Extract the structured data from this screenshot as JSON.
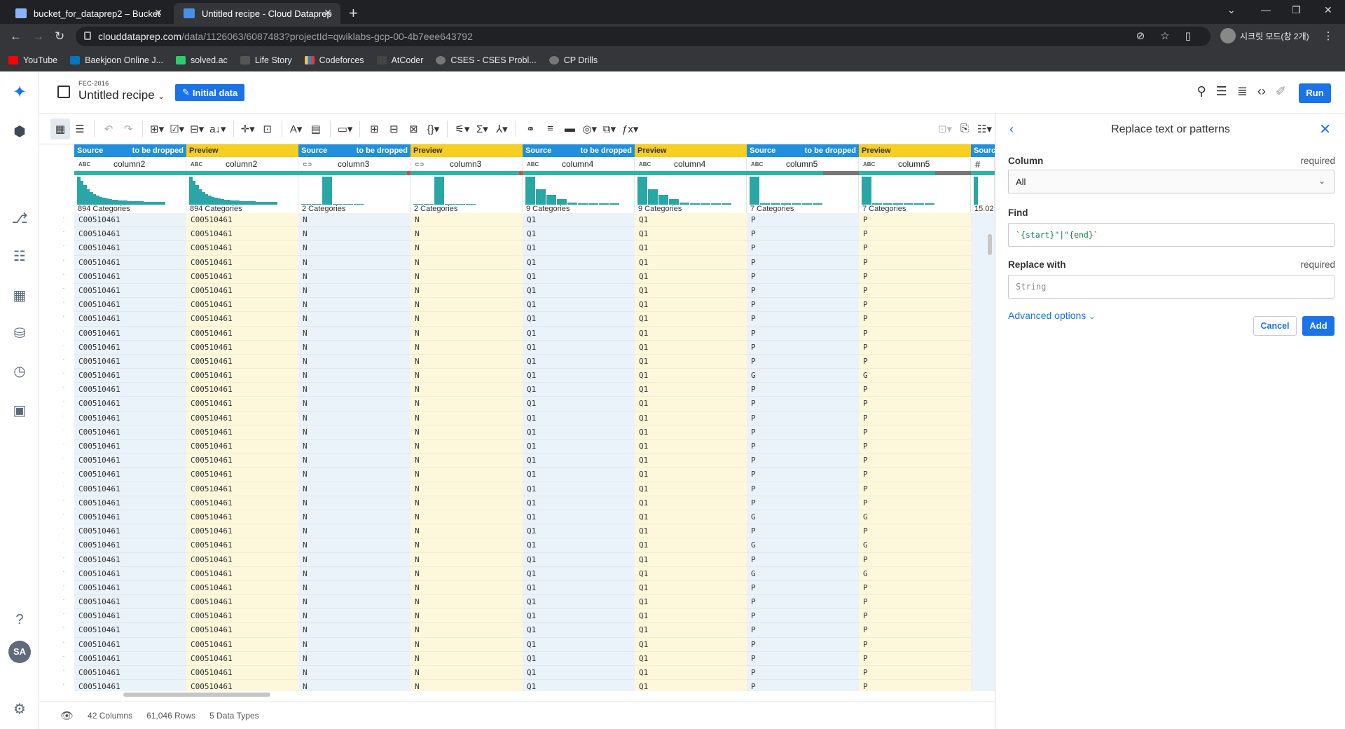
{
  "browser": {
    "tabs": [
      {
        "title": "bucket_for_dataprep2 – Bucket"
      },
      {
        "title": "Untitled recipe - Cloud Dataprep"
      }
    ],
    "url_domain": "clouddataprep.com",
    "url_path": "/data/1126063/6087483?projectId=qwiklabs-gcp-00-4b7eee643792",
    "profile_label": "시크릿 모드(창 2개)",
    "bookmarks": [
      "YouTube",
      "Baekjoon Online J...",
      "solved.ac",
      "Life Story",
      "Codeforces",
      "AtCoder",
      "CSES - CSES Probl...",
      "CP Drills"
    ]
  },
  "header": {
    "flow_name": "FEC-2016",
    "recipe_name": "Untitled recipe",
    "initial_data_label": "Initial data",
    "run_label": "Run"
  },
  "user": {
    "initials": "SA"
  },
  "grid": {
    "columns": [
      {
        "kind": "Source",
        "tag": "to be dropped",
        "type": "ABC",
        "name": "column2",
        "categories": "894 Categories"
      },
      {
        "kind": "Preview",
        "tag": "",
        "type": "ABC",
        "name": "column2",
        "categories": "894 Categories"
      },
      {
        "kind": "Source",
        "tag": "to be dropped",
        "type": "BOOL",
        "name": "column3",
        "categories": "2 Categories"
      },
      {
        "kind": "Preview",
        "tag": "",
        "type": "BOOL",
        "name": "column3",
        "categories": "2 Categories"
      },
      {
        "kind": "Source",
        "tag": "to be dropped",
        "type": "ABC",
        "name": "column4",
        "categories": "9 Categories"
      },
      {
        "kind": "Preview",
        "tag": "",
        "type": "ABC",
        "name": "column4",
        "categories": "9 Categories"
      },
      {
        "kind": "Source",
        "tag": "to be dropped",
        "type": "ABC",
        "name": "column5",
        "categories": "7 Categories"
      },
      {
        "kind": "Preview",
        "tag": "",
        "type": "ABC",
        "name": "column5",
        "categories": "7 Categories"
      }
    ],
    "partial_column": {
      "kind": "Sourc",
      "type": "#",
      "summary": "15.02"
    },
    "rows_col2": [
      "C00510461",
      "C00510461",
      "C00510461",
      "C00510461",
      "C00510461",
      "C00510461",
      "C00510461",
      "C00510461",
      "C00510461",
      "C00510461",
      "C00510461",
      "C00510461",
      "C00510461",
      "C00510461",
      "C00510461",
      "C00510461",
      "C00510461",
      "C00510461",
      "C00510461",
      "C00510461",
      "C00510461",
      "C00510461",
      "C00510461",
      "C00510461",
      "C00510461",
      "C00510461",
      "C00510461",
      "C00510461",
      "C00510461",
      "C00510461",
      "C00510461",
      "C00510461",
      "C00510461",
      "C00510461"
    ],
    "rows_col3": [
      "N",
      "N",
      "N",
      "N",
      "N",
      "N",
      "N",
      "N",
      "N",
      "N",
      "N",
      "N",
      "N",
      "N",
      "N",
      "N",
      "N",
      "N",
      "N",
      "N",
      "N",
      "N",
      "N",
      "N",
      "N",
      "N",
      "N",
      "N",
      "N",
      "N",
      "N",
      "N",
      "N",
      "N"
    ],
    "rows_col4": [
      "Q1",
      "Q1",
      "Q1",
      "Q1",
      "Q1",
      "Q1",
      "Q1",
      "Q1",
      "Q1",
      "Q1",
      "Q1",
      "Q1",
      "Q1",
      "Q1",
      "Q1",
      "Q1",
      "Q1",
      "Q1",
      "Q1",
      "Q1",
      "Q1",
      "Q1",
      "Q1",
      "Q1",
      "Q1",
      "Q1",
      "Q1",
      "Q1",
      "Q1",
      "Q1",
      "Q1",
      "Q1",
      "Q1",
      "Q1"
    ],
    "rows_col5": [
      "P",
      "P",
      "P",
      "P",
      "P",
      "P",
      "P",
      "P",
      "P",
      "P",
      "P",
      "G",
      "P",
      "P",
      "P",
      "P",
      "P",
      "P",
      "P",
      "P",
      "P",
      "G",
      "P",
      "G",
      "P",
      "G",
      "P",
      "P",
      "P",
      "P",
      "P",
      "P",
      "P",
      "P"
    ]
  },
  "footer": {
    "columns": "42 Columns",
    "rows": "61,046 Rows",
    "types": "5 Data Types"
  },
  "panel": {
    "title": "Replace text or patterns",
    "column_label": "Column",
    "column_required": "required",
    "column_value": "All",
    "find_label": "Find",
    "find_value": "`{start}\"|\"{end}`",
    "replace_label": "Replace with",
    "replace_required": "required",
    "replace_placeholder": "String",
    "advanced_label": "Advanced options",
    "cancel_label": "Cancel",
    "add_label": "Add"
  }
}
